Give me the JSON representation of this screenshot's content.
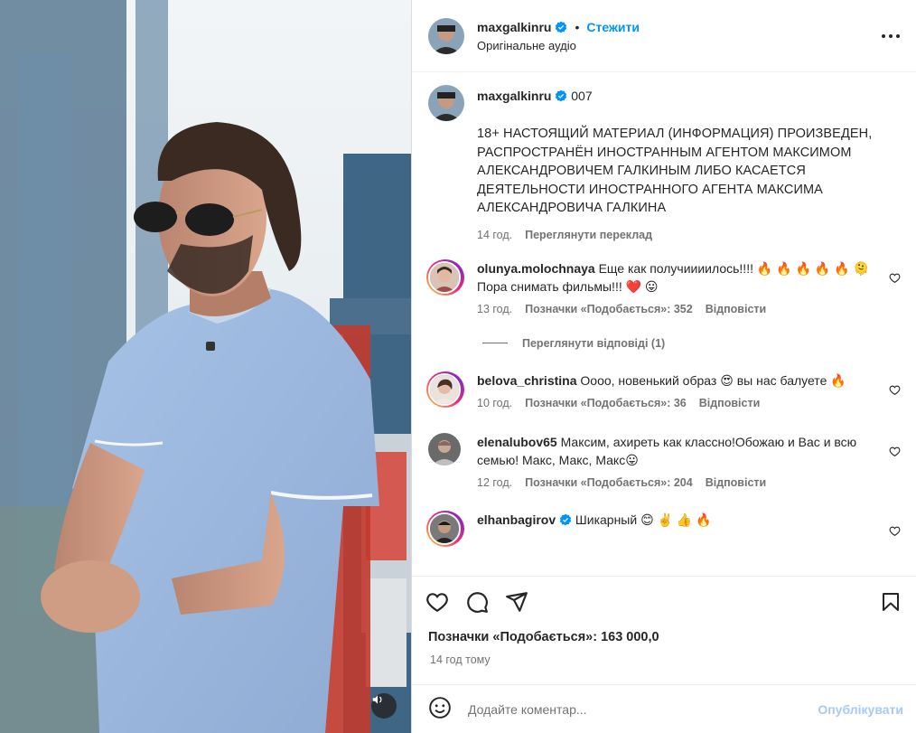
{
  "post": {
    "username": "maxgalkinru",
    "follow_label": "Стежити",
    "audio_label": "Оригінальне аудіо",
    "more_icon": "more-horizontal-icon"
  },
  "caption": {
    "username": "maxgalkinru",
    "text_inline": "007",
    "text_body": "18+ НАСТОЯЩИЙ МАТЕРИАЛ (ИНФОРМАЦИЯ) ПРОИЗВЕДЕН, РАСПРОСТРАНЁН ИНОСТРАННЫМ АГЕНТОМ МАКСИМОМ АЛЕКСАНДРОВИЧЕМ ГАЛКИНЫМ ЛИБО КАСАЕТСЯ ДЕЯТЕЛЬНОСТИ ИНОСТРАННОГО АГЕНТА МАКСИМА АЛЕКСАНДРОВИЧА ГАЛКИНА",
    "time": "14 год.",
    "translate_label": "Переглянути переклад"
  },
  "comments": [
    {
      "username": "olunya.molochnaya",
      "text": "Еще как получиииилось!!!! 🔥 🔥 🔥 🔥 🔥 🫠 Пора снимать фильмы!!! ❤️ 😛",
      "time": "13 год.",
      "likes": "Позначки «Подобається»: 352",
      "reply_label": "Відповісти",
      "view_replies": "Переглянути відповіді (1)"
    },
    {
      "username": "belova_christina",
      "text": "Оооо, новенький образ 😍 вы нас балуете 🔥",
      "time": "10 год.",
      "likes": "Позначки «Подобається»: 36",
      "reply_label": "Відповісти"
    },
    {
      "username": "elenalubov65",
      "text": "Максим, ахиреть как классно!Обожаю и Вас и всю семью! Макс, Макс, Макс😛",
      "time": "12 год.",
      "likes": "Позначки «Подобається»: 204",
      "reply_label": "Відповісти"
    },
    {
      "username": "elhanbagirov",
      "text": "Шикарный 😊 ✌️ 👍 🔥"
    }
  ],
  "footer": {
    "likes_label": "Позначки «Подобається»: 163 000,0",
    "time_ago": "14 год тому",
    "comment_placeholder": "Додайте коментар...",
    "publish_label": "Опублікувати"
  },
  "colors": {
    "accent": "#0095f6",
    "publish_disabled": "#a8c9f5",
    "verified": "#0095f6",
    "text_secondary": "#737373"
  }
}
